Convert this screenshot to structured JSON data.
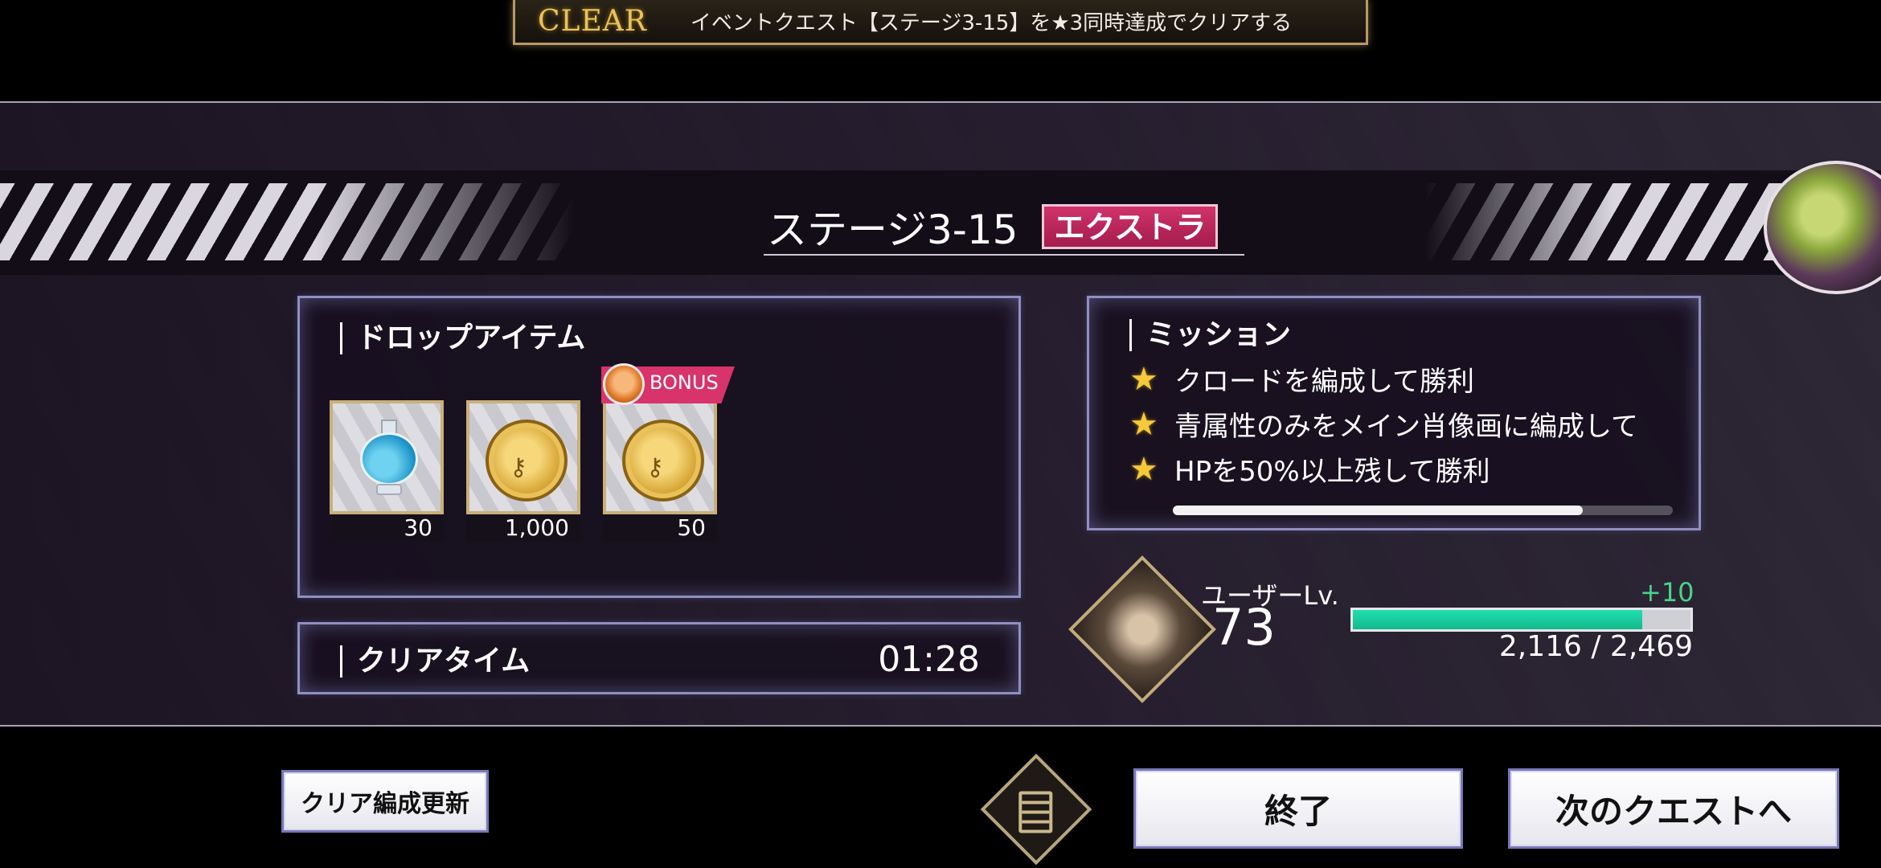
{
  "banner": {
    "clear_label": "CLEAR",
    "message": "イベントクエスト【ステージ3-15】を★3同時達成でクリアする"
  },
  "stage": {
    "name": "ステージ3-15",
    "badge": "エクストラ"
  },
  "drops": {
    "heading": "ドロップアイテム",
    "bonus_label": "BONUS",
    "items": [
      {
        "icon": "potion-icon",
        "quantity": "30"
      },
      {
        "icon": "gold-key-coin-icon",
        "quantity": "1,000"
      },
      {
        "icon": "gold-key-coin-icon",
        "quantity": "50",
        "bonus": true
      }
    ]
  },
  "clear_time": {
    "heading": "クリアタイム",
    "value": "01:28"
  },
  "missions": {
    "heading": "ミッション",
    "items": [
      {
        "label": "クロードを編成して勝利",
        "achieved": true
      },
      {
        "label": "青属性のみをメイン肖像画に編成して",
        "achieved": true
      },
      {
        "label": "HPを50%以上残して勝利",
        "achieved": true
      }
    ]
  },
  "user": {
    "level_label": "ユーザーLv.",
    "level": "73",
    "exp_gain": "+10",
    "exp_text": "2,116 / 2,469",
    "exp_current": 2116,
    "exp_max": 2469
  },
  "buttons": {
    "update_formation": "クリア編成更新",
    "end": "終了",
    "next_quest": "次のクエストへ"
  },
  "colors": {
    "accent_pink": "#d8336a",
    "exp_green": "#20e0b0",
    "star_gold": "#f4c93c",
    "panel_border": "#8f8fc2"
  }
}
